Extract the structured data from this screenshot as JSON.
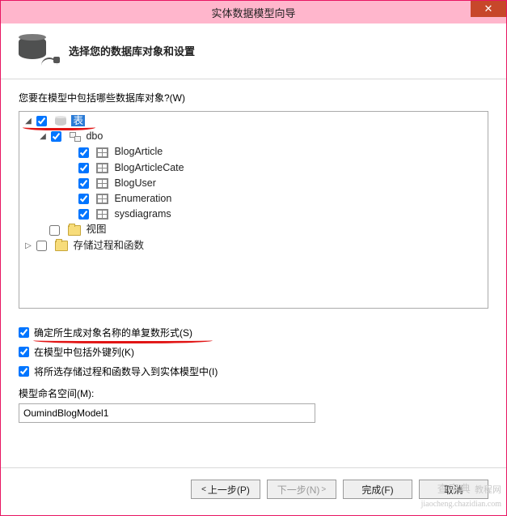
{
  "window": {
    "title": "实体数据模型向导"
  },
  "header": {
    "subtitle": "选择您的数据库对象和设置"
  },
  "tree": {
    "label_select_objects": "您要在模型中包括哪些数据库对象?(W)",
    "root_tables": "表",
    "schema_dbo": "dbo",
    "views": "视图",
    "sprocs": "存储过程和函数",
    "tables": [
      "BlogArticle",
      "BlogArticleCate",
      "BlogUser",
      "Enumeration",
      "sysdiagrams"
    ]
  },
  "options": {
    "pluralize": "确定所生成对象名称的单复数形式(S)",
    "include_fk": "在模型中包括外键列(K)",
    "import_sprocs": "将所选存储过程和函数导入到实体模型中(I)"
  },
  "namespace": {
    "label": "模型命名空间(M):",
    "value": "OumindBlogModel1"
  },
  "buttons": {
    "back": "上一步(P)",
    "next": "下一步(N)",
    "finish": "完成(F)",
    "cancel": "取消"
  },
  "watermark": {
    "line1": "查字典",
    "line2": "jiaocheng.chazidian.com",
    "line3": "教程网"
  }
}
